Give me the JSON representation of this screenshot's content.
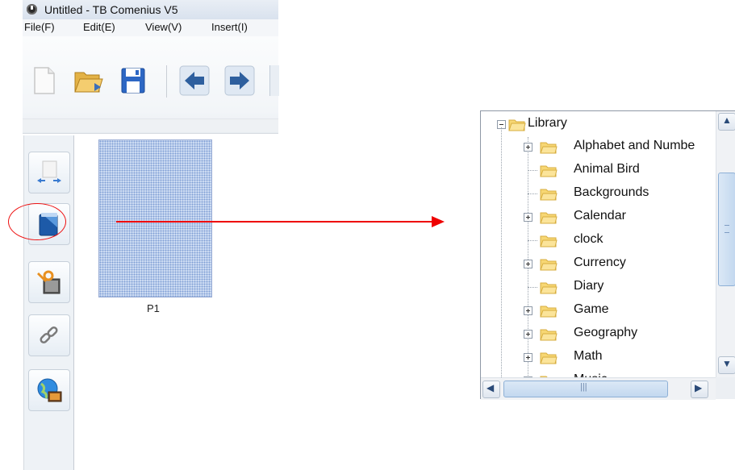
{
  "window": {
    "title": "Untitled - TB Comenius V5"
  },
  "menu": [
    "File(F)",
    "Edit(E)",
    "View(V)",
    "Insert(I)"
  ],
  "toolbar": {
    "buttons": [
      "new-document-icon",
      "open-folder-icon",
      "save-disk-icon",
      "back-arrow-icon",
      "forward-arrow-icon"
    ]
  },
  "sidebar": {
    "buttons": [
      "page-sorter-icon",
      "gallery-library-icon",
      "tools-icon",
      "link-icon",
      "web-resources-icon"
    ],
    "highlighted": "gallery-library-icon"
  },
  "page_thumbnail": {
    "label": "P1"
  },
  "annotation": {
    "color": "#ee1111"
  },
  "tree": {
    "root": "Library",
    "items": [
      {
        "label": "Alphabet and Numbe",
        "expandable": true
      },
      {
        "label": "Animal Bird",
        "expandable": false
      },
      {
        "label": "Backgrounds",
        "expandable": false
      },
      {
        "label": "Calendar",
        "expandable": true
      },
      {
        "label": "clock",
        "expandable": false
      },
      {
        "label": "Currency",
        "expandable": true
      },
      {
        "label": "Diary",
        "expandable": false
      },
      {
        "label": "Game",
        "expandable": true
      },
      {
        "label": "Geography",
        "expandable": true
      },
      {
        "label": "Math",
        "expandable": true
      },
      {
        "label": "Music",
        "expandable": true
      }
    ]
  },
  "scrollbar": {
    "up": "▲",
    "down": "▼",
    "left": "◀",
    "right": "▶"
  }
}
